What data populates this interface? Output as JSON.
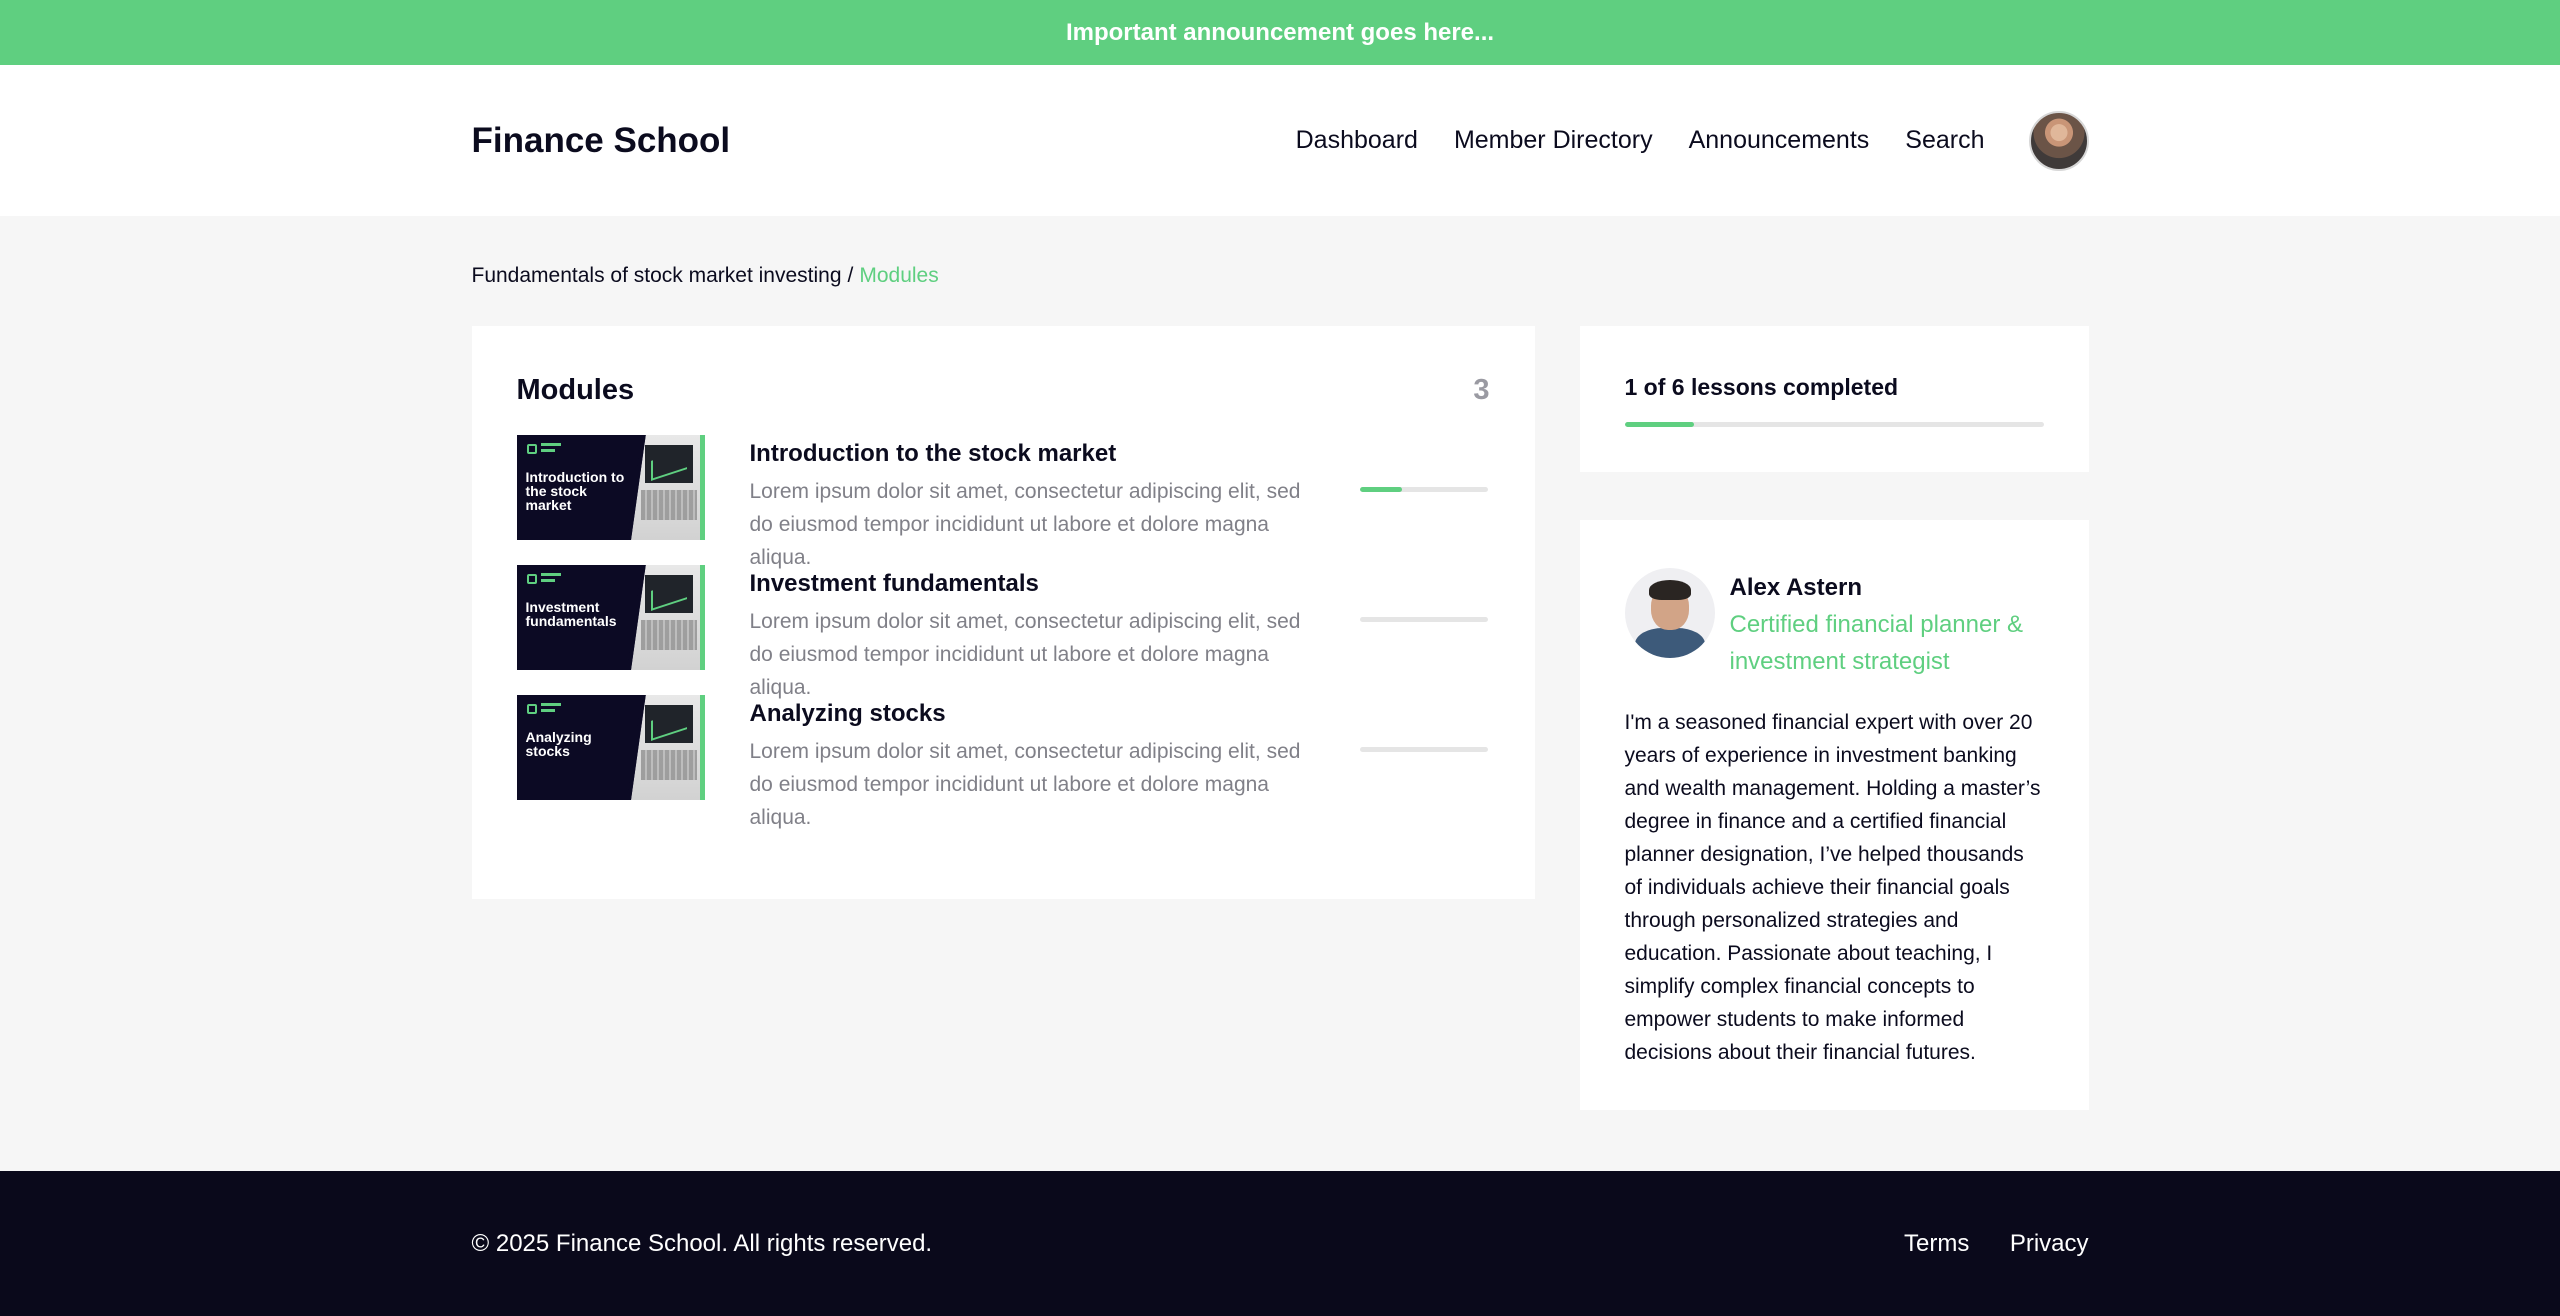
{
  "announcement": "Important announcement goes here...",
  "header": {
    "brand": "Finance School",
    "nav": [
      "Dashboard",
      "Member Directory",
      "Announcements",
      "Search"
    ]
  },
  "breadcrumb": {
    "course": "Fundamentals of stock market investing",
    "separator": "/",
    "current": "Modules"
  },
  "modules": {
    "title": "Modules",
    "count": "3",
    "items": [
      {
        "title": "Introduction to the stock market",
        "thumb_title": "Introduction to the stock market",
        "description": "Lorem ipsum dolor sit amet, consectetur adipiscing elit, sed do eiusmod tempor incididunt ut labore et dolore magna aliqua.",
        "progress": 0.33
      },
      {
        "title": "Investment fundamentals",
        "thumb_title": "Investment fundamentals",
        "description": "Lorem ipsum dolor sit amet, consectetur adipiscing elit, sed do eiusmod tempor incididunt ut labore et dolore magna aliqua.",
        "progress": 0
      },
      {
        "title": "Analyzing stocks",
        "thumb_title": "Analyzing stocks",
        "description": "Lorem ipsum dolor sit amet, consectetur adipiscing elit, sed do eiusmod tempor incididunt ut labore et dolore magna aliqua.",
        "progress": 0
      }
    ]
  },
  "progress": {
    "label": "1 of 6 lessons completed",
    "completed": 1,
    "total": 6
  },
  "instructor": {
    "name": "Alex Astern",
    "role": "Certified financial planner & investment strategist",
    "bio": "I'm a seasoned financial expert with over 20 years of experience in investment banking and wealth management. Holding a master’s degree in finance and a certified financial planner designation, I’ve helped thousands of individuals achieve their financial goals through personalized strategies and education. Passionate about teaching, I simplify complex financial concepts to empower students to make informed decisions about their financial futures."
  },
  "footer": {
    "copyright": "© 2025 Finance School. All rights reserved.",
    "links": [
      "Terms",
      "Privacy"
    ]
  },
  "colors": {
    "accent": "#5fcf80",
    "dark": "#0a091b",
    "muted": "#808088"
  }
}
